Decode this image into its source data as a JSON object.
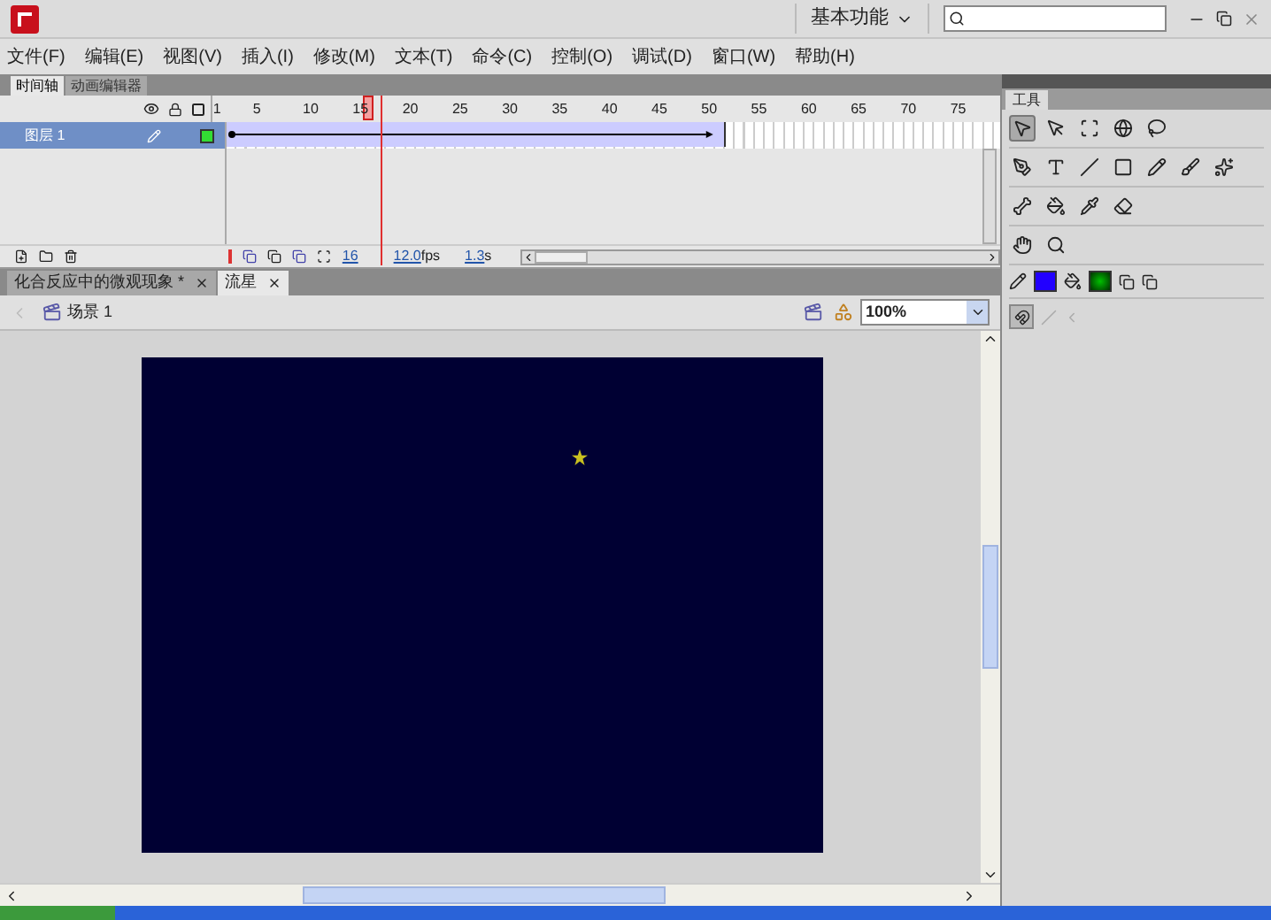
{
  "app": {
    "workspace": "基本功能"
  },
  "menu": [
    "文件(F)",
    "编辑(E)",
    "视图(V)",
    "插入(I)",
    "修改(M)",
    "文本(T)",
    "命令(C)",
    "控制(O)",
    "调试(D)",
    "窗口(W)",
    "帮助(H)"
  ],
  "timeline": {
    "tabs": [
      {
        "label": "时间轴",
        "selected": true
      },
      {
        "label": "动画编辑器",
        "selected": false
      }
    ],
    "ruler": [
      "1",
      "5",
      "10",
      "15",
      "20",
      "25",
      "30",
      "35",
      "40",
      "45",
      "50",
      "55",
      "60",
      "65",
      "70",
      "75"
    ],
    "layers": [
      {
        "name": "图层 1",
        "selected": true
      }
    ],
    "current_frame": "16",
    "frame_rate": "12.0",
    "frame_rate_unit": "fps",
    "elapsed": "1.3",
    "elapsed_unit": "s"
  },
  "documents": [
    {
      "label": "化合反应中的微观现象 *",
      "selected": false
    },
    {
      "label": "流星",
      "selected": true
    }
  ],
  "scene": {
    "label": "场景 1",
    "zoom": "100%"
  },
  "tools": {
    "tab": "工具",
    "rows": [
      [
        {
          "kind": "select",
          "selected": true
        },
        {
          "kind": "subselect",
          "selected": false
        },
        {
          "kind": "transform",
          "selected": false
        },
        {
          "kind": "rotate3d",
          "selected": false
        },
        {
          "kind": "lasso",
          "selected": false
        }
      ],
      [
        {
          "kind": "pen",
          "selected": false
        },
        {
          "kind": "text",
          "selected": false
        },
        {
          "kind": "line",
          "selected": false
        },
        {
          "kind": "rect",
          "selected": false
        },
        {
          "kind": "pencil",
          "selected": false
        },
        {
          "kind": "brush",
          "selected": false
        },
        {
          "kind": "deco",
          "selected": false
        }
      ],
      [
        {
          "kind": "bone",
          "selected": false
        },
        {
          "kind": "bucket",
          "selected": false
        },
        {
          "kind": "dropper",
          "selected": false
        },
        {
          "kind": "eraser",
          "selected": false
        }
      ],
      [
        {
          "kind": "hand",
          "selected": false
        },
        {
          "kind": "zoom",
          "selected": false
        }
      ]
    ]
  }
}
